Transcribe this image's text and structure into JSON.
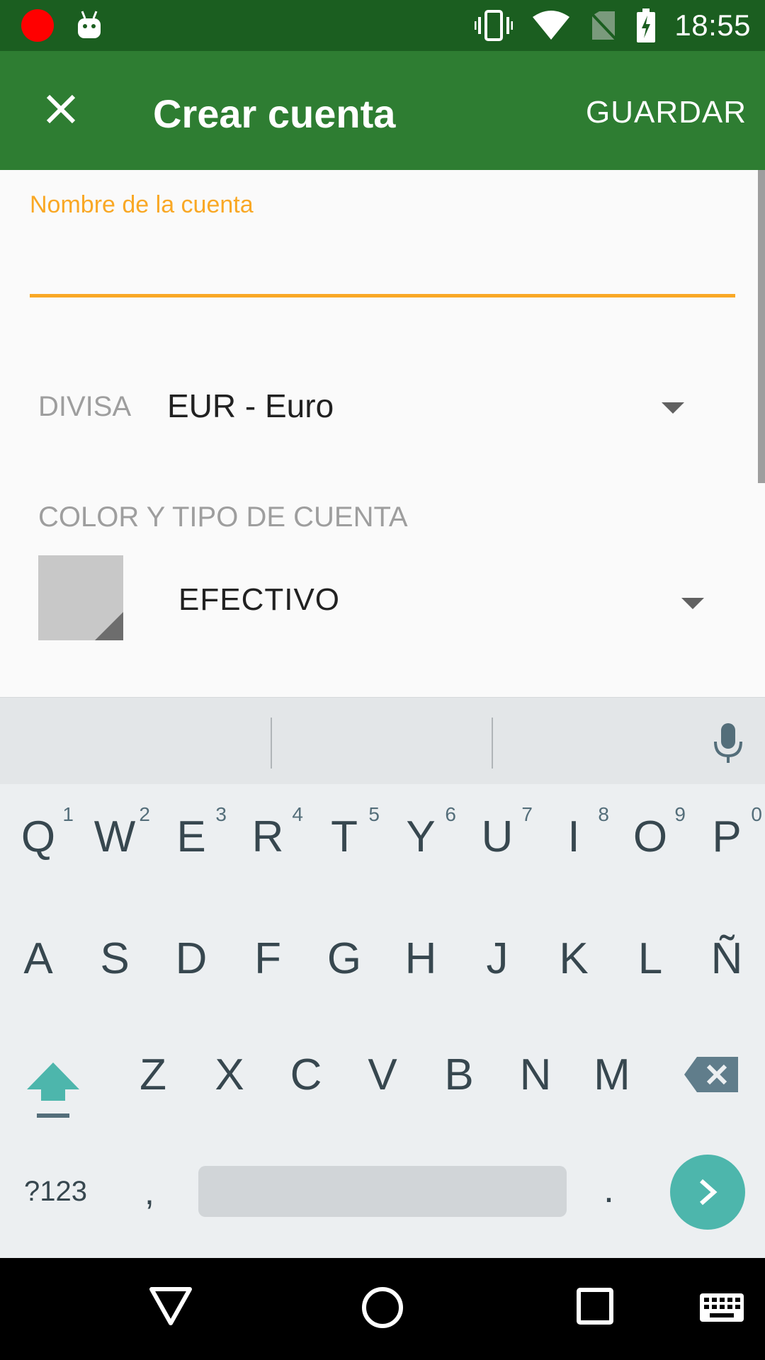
{
  "status_bar": {
    "time": "18:55",
    "icons": [
      "record-dot-icon",
      "android-icon",
      "vibrate-icon",
      "wifi-icon",
      "no-sim-icon",
      "battery-charging-icon"
    ],
    "colors": {
      "background": "#1b5e20",
      "record": "#ff0000"
    }
  },
  "app_bar": {
    "close_icon": "close-icon",
    "title": "Crear cuenta",
    "save_label": "GUARDAR",
    "color": "#2e7d32"
  },
  "form": {
    "name_field": {
      "label": "Nombre de la cuenta",
      "value": "",
      "accent": "#f9a825"
    },
    "currency": {
      "label": "DIVISA",
      "value": "EUR - Euro"
    },
    "color_type": {
      "label": "COLOR Y TIPO DE CUENTA",
      "type_value": "EFECTIVO",
      "swatch_color": "#c8c8c8"
    }
  },
  "keyboard": {
    "row1": [
      {
        "key": "Q",
        "hint": "1"
      },
      {
        "key": "W",
        "hint": "2"
      },
      {
        "key": "E",
        "hint": "3"
      },
      {
        "key": "R",
        "hint": "4"
      },
      {
        "key": "T",
        "hint": "5"
      },
      {
        "key": "Y",
        "hint": "6"
      },
      {
        "key": "U",
        "hint": "7"
      },
      {
        "key": "I",
        "hint": "8"
      },
      {
        "key": "O",
        "hint": "9"
      },
      {
        "key": "P",
        "hint": "0"
      }
    ],
    "row2": [
      "A",
      "S",
      "D",
      "F",
      "G",
      "H",
      "J",
      "K",
      "L",
      "Ñ"
    ],
    "row3": [
      "Z",
      "X",
      "C",
      "V",
      "B",
      "N",
      "M"
    ],
    "symbols_label": "?123",
    "comma": ",",
    "period": ".",
    "icons": [
      "mic-icon",
      "shift-icon",
      "backspace-icon",
      "go-arrow-icon"
    ],
    "accent": "#4db6ac"
  },
  "nav_bar": {
    "icons": [
      "back-icon",
      "home-icon",
      "recents-icon",
      "keyboard-switch-icon"
    ]
  }
}
